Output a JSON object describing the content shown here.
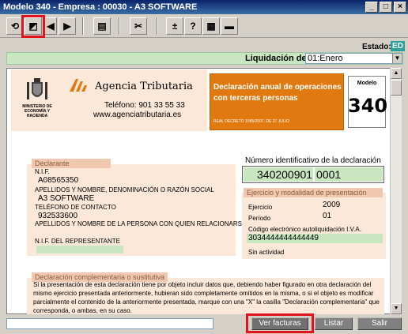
{
  "window": {
    "title": "Modelo 340 - Empresa : 00030 - A3 SOFTWARE",
    "minimize": "_",
    "maximize": "□",
    "close": "×"
  },
  "toolbar": {
    "tools": [
      {
        "name": "refresh-icon",
        "glyph": "⟲"
      },
      {
        "name": "edit-icon",
        "glyph": "◩"
      },
      {
        "name": "prev-icon",
        "glyph": "◀"
      },
      {
        "name": "next-icon",
        "glyph": "▶"
      },
      {
        "name": "print-icon",
        "glyph": "▤"
      },
      {
        "name": "scissors-icon",
        "glyph": "✂"
      },
      {
        "name": "plus-minus-icon",
        "glyph": "±"
      },
      {
        "name": "help-icon",
        "glyph": "?"
      },
      {
        "name": "calculator-icon",
        "glyph": "▦"
      },
      {
        "name": "minus-icon",
        "glyph": "▬"
      }
    ]
  },
  "estado": {
    "label": "Estado:",
    "value": "ED"
  },
  "liquidacion": {
    "label": "Liquidación de:",
    "value": "01:Enero",
    "arrow": "▼"
  },
  "header": {
    "ministerio": "MINISTERIO DE ECONOMÍA Y HACIENDA",
    "agency": "Agencia Tributaria",
    "telefono": "Teléfono: 901 33 55 33",
    "web": "www.agenciatributaria.es",
    "declaracion_title": "Declaración anual de operaciones con terceras personas",
    "real_decreto": "REAL DECRETO 1065/2007, DE 27 JULIO",
    "modelo_label": "Modelo",
    "modelo_number": "340"
  },
  "declarante": {
    "section": "Declarante",
    "nif_label": "N.I.F.",
    "nif": "A08565350",
    "nombre_label": "APELLIDOS Y NOMBRE, DENOMINACIÓN O RAZÓN SOCIAL",
    "nombre": "A3 SOFTWARE",
    "telefono_label": "TELÉFONO DE CONTACTO",
    "telefono": "932533600",
    "relacion_label": "APELLIDOS Y NOMBRE DE LA PERSONA CON QUIEN RELACIONARSE",
    "relacion": "",
    "representante_label": "N.I.F. DEL REPRESENTANTE",
    "representante": ""
  },
  "identificativo": {
    "label": "Número identificativo de la declaración",
    "part1": "340200901",
    "part2": "0001"
  },
  "ejercicio": {
    "section": "Ejercicio y modalidad de presentación",
    "ejercicio_label": "Ejercicio",
    "ejercicio": "2009",
    "periodo_label": "Período",
    "periodo": "01",
    "codigo_label": "Código electrónico autoliquidación I.V.A.",
    "codigo": "3034444444444449",
    "sin_actividad_label": "Sin actividad"
  },
  "complementaria": {
    "section": "Declaración complementaria o sustitutiva",
    "text": "Si la presentación de esta declaración tiene por objeto incluir datos que, debiendo haber figurado en otra declaración del mismo ejercicio presentada anteriormente, hubieran sido completamente omitidos en la misma, o si el objeto es modificar parcialmente el contenido de la anteriormente presentada, marque con una \"X\" la casilla \"Declaración complementaria\" que corresponda, o ambas, en su caso."
  },
  "buttons": {
    "ver_facturas": "Ver facturas",
    "listar": "Listar",
    "salir": "Salir"
  }
}
